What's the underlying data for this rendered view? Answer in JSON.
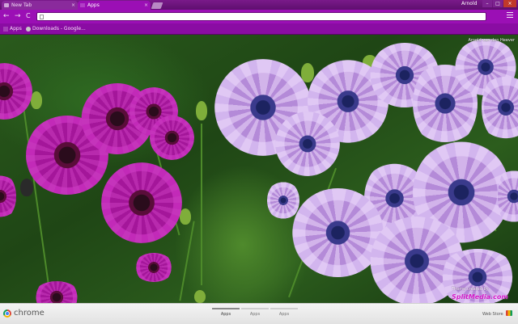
{
  "tabs": [
    {
      "title": "New Tab",
      "active": false
    },
    {
      "title": "Apps",
      "active": true
    }
  ],
  "window": {
    "user_name": "Arnold"
  },
  "toolbar": {
    "back": "←",
    "forward": "→",
    "reload": "C",
    "omnibox_value": ""
  },
  "bookmarks": [
    {
      "label": "Apps",
      "icon": "apps-grid-icon"
    },
    {
      "label": "Downloads - Google...",
      "icon": "downloads-page-icon"
    }
  ],
  "theme": {
    "profile_name": "Arnold van den Heever",
    "credit_line": "Theme created by",
    "credit_site": "SplitMedia.com"
  },
  "footer": {
    "brand": "chrome",
    "sections": [
      "Apps",
      "Apps",
      "Apps"
    ],
    "active_section": 0,
    "web_store": "Web Store"
  },
  "colors": {
    "theme_purple": "#9b0fb5",
    "tabstrip_purple": "#7a1a8a",
    "bookmark_bar": "#8a0ca3"
  }
}
